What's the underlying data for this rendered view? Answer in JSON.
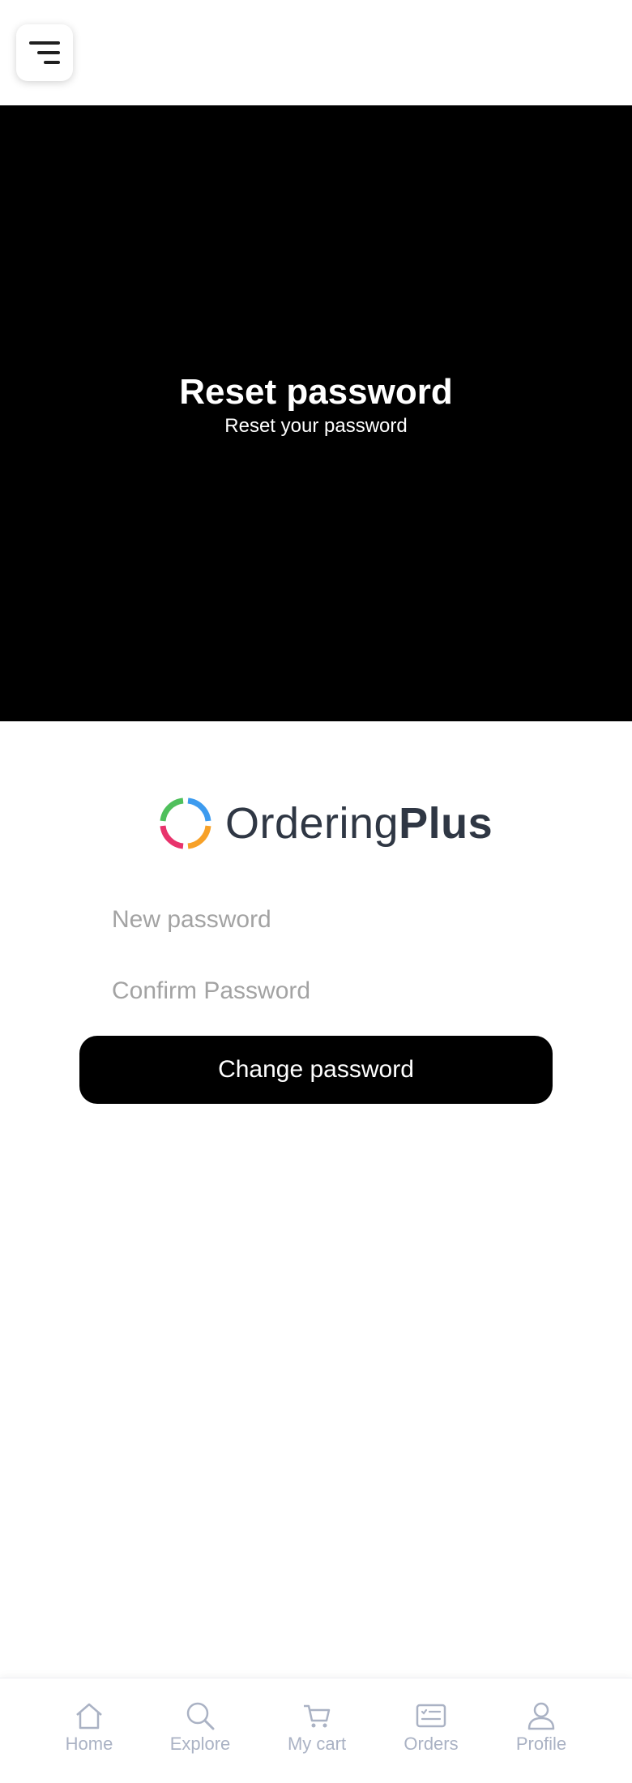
{
  "header": {
    "menu_icon": "hamburger-menu-icon"
  },
  "hero": {
    "title": "Reset password",
    "subtitle": "Reset your password"
  },
  "logo": {
    "text_light": "Ordering",
    "text_bold": "Plus",
    "ring_colors": [
      "#3d9bef",
      "#f7a128",
      "#e8336c",
      "#4fc05c"
    ]
  },
  "form": {
    "new_password_placeholder": "New password",
    "confirm_password_placeholder": "Confirm Password",
    "submit_label": "Change password"
  },
  "bottom_nav": {
    "items": [
      {
        "label": "Home",
        "icon": "home-icon"
      },
      {
        "label": "Explore",
        "icon": "search-icon"
      },
      {
        "label": "My cart",
        "icon": "cart-icon"
      },
      {
        "label": "Orders",
        "icon": "orders-icon"
      },
      {
        "label": "Profile",
        "icon": "profile-icon"
      }
    ]
  },
  "colors": {
    "hero_bg": "#000000",
    "nav_inactive": "#aab2c4",
    "button_bg": "#000000"
  }
}
